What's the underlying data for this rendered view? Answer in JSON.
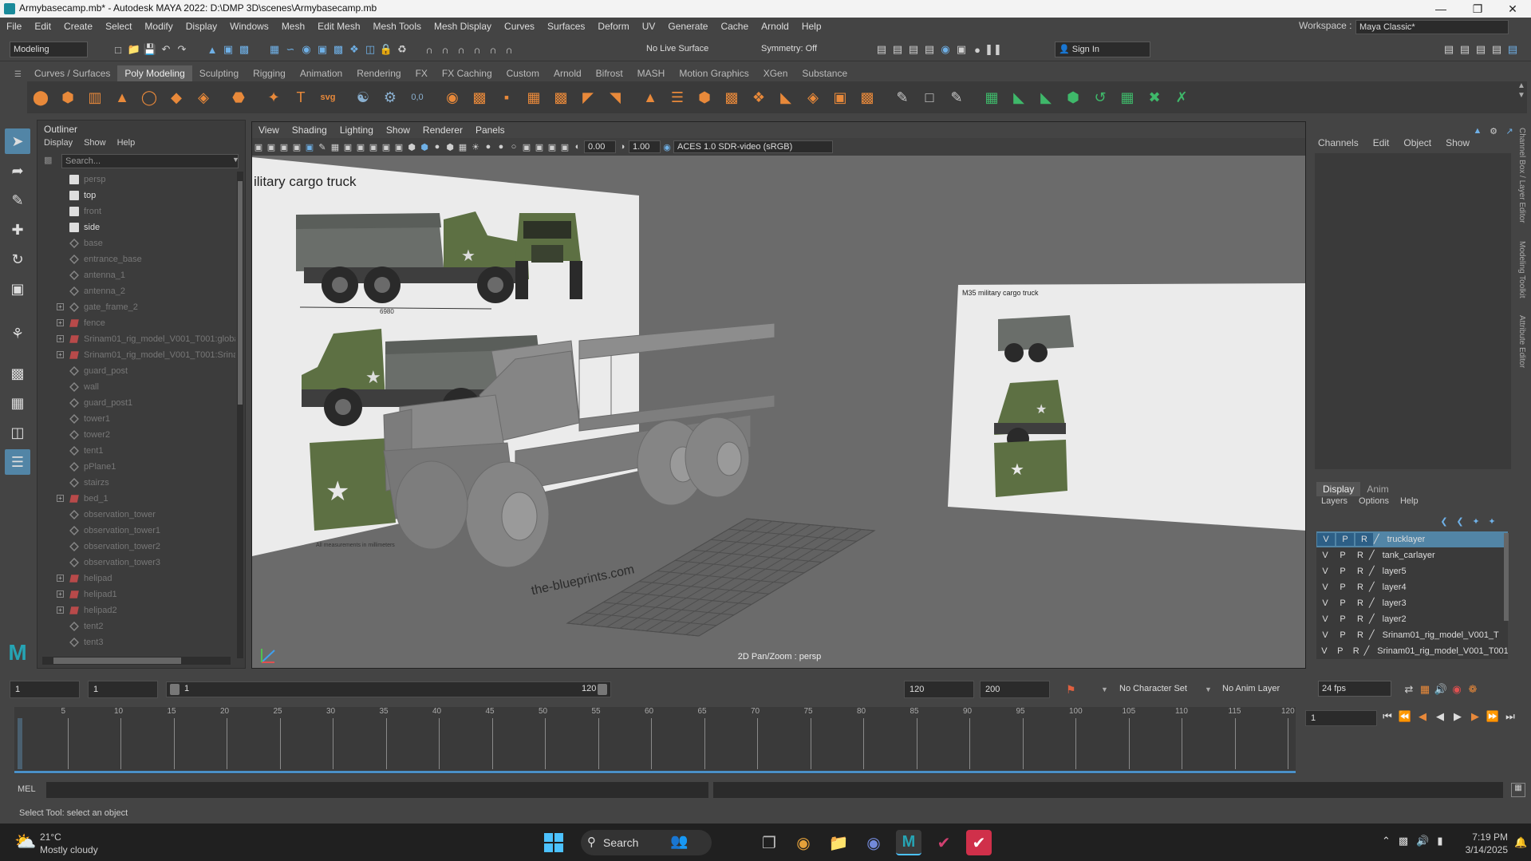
{
  "window": {
    "title": "Armybasecamp.mb* - Autodesk MAYA 2022: D:\\DMP 3D\\scenes\\Armybasecamp.mb"
  },
  "menus": [
    "File",
    "Edit",
    "Create",
    "Select",
    "Modify",
    "Display",
    "Windows",
    "Mesh",
    "Edit Mesh",
    "Mesh Tools",
    "Mesh Display",
    "Curves",
    "Surfaces",
    "Deform",
    "UV",
    "Generate",
    "Cache",
    "Arnold",
    "Help"
  ],
  "workspace": {
    "label": "Workspace :",
    "value": "Maya Classic*"
  },
  "statusline": {
    "mode": "Modeling",
    "live_surface": "No Live Surface",
    "symmetry": "Symmetry: Off",
    "sign_in": "Sign In"
  },
  "shelf_tabs": [
    "Curves / Surfaces",
    "Poly Modeling",
    "Sculpting",
    "Rigging",
    "Animation",
    "Rendering",
    "FX",
    "FX Caching",
    "Custom",
    "Arnold",
    "Bifrost",
    "MASH",
    "Motion Graphics",
    "XGen",
    "Substance"
  ],
  "shelf_active": "Poly Modeling",
  "outliner": {
    "title": "Outliner",
    "menu": [
      "Display",
      "Show",
      "Help"
    ],
    "search_placeholder": "Search...",
    "items": [
      {
        "name": "persp",
        "type": "cam",
        "dim": true,
        "expand": false
      },
      {
        "name": "top",
        "type": "cam",
        "dim": false,
        "expand": false
      },
      {
        "name": "front",
        "type": "cam",
        "dim": true,
        "expand": false
      },
      {
        "name": "side",
        "type": "cam",
        "dim": false,
        "expand": false
      },
      {
        "name": "base",
        "type": "mesh",
        "dim": true,
        "expand": false
      },
      {
        "name": "entrance_base",
        "type": "mesh",
        "dim": true,
        "expand": false
      },
      {
        "name": "antenna_1",
        "type": "mesh",
        "dim": true,
        "expand": false
      },
      {
        "name": "antenna_2",
        "type": "mesh",
        "dim": true,
        "expand": false
      },
      {
        "name": "gate_frame_2",
        "type": "mesh",
        "dim": true,
        "expand": true
      },
      {
        "name": "fence",
        "type": "grp",
        "dim": true,
        "expand": true
      },
      {
        "name": "Srinam01_rig_model_V001_T001:globa",
        "type": "grp",
        "dim": true,
        "expand": true
      },
      {
        "name": "Srinam01_rig_model_V001_T001:Srina",
        "type": "grp",
        "dim": true,
        "expand": true
      },
      {
        "name": "guard_post",
        "type": "mesh",
        "dim": true,
        "expand": false
      },
      {
        "name": "wall",
        "type": "mesh",
        "dim": true,
        "expand": false
      },
      {
        "name": "guard_post1",
        "type": "mesh",
        "dim": true,
        "expand": false
      },
      {
        "name": "tower1",
        "type": "mesh",
        "dim": true,
        "expand": false
      },
      {
        "name": "tower2",
        "type": "mesh",
        "dim": true,
        "expand": false
      },
      {
        "name": "tent1",
        "type": "mesh",
        "dim": true,
        "expand": false
      },
      {
        "name": "pPlane1",
        "type": "mesh",
        "dim": true,
        "expand": false
      },
      {
        "name": "stairzs",
        "type": "mesh",
        "dim": true,
        "expand": false
      },
      {
        "name": "bed_1",
        "type": "grp",
        "dim": true,
        "expand": true
      },
      {
        "name": "observation_tower",
        "type": "mesh",
        "dim": true,
        "expand": false
      },
      {
        "name": "observation_tower1",
        "type": "mesh",
        "dim": true,
        "expand": false
      },
      {
        "name": "observation_tower2",
        "type": "mesh",
        "dim": true,
        "expand": false
      },
      {
        "name": "observation_tower3",
        "type": "mesh",
        "dim": true,
        "expand": false
      },
      {
        "name": "helipad",
        "type": "grp",
        "dim": true,
        "expand": true
      },
      {
        "name": "helipad1",
        "type": "grp",
        "dim": true,
        "expand": true
      },
      {
        "name": "helipad2",
        "type": "grp",
        "dim": true,
        "expand": true
      },
      {
        "name": "tent2",
        "type": "mesh",
        "dim": true,
        "expand": false
      },
      {
        "name": "tent3",
        "type": "mesh",
        "dim": true,
        "expand": false
      }
    ]
  },
  "viewport": {
    "menu": [
      "View",
      "Shading",
      "Lighting",
      "Show",
      "Renderer",
      "Panels"
    ],
    "exposure": "0.00",
    "gamma": "1.00",
    "color_space": "ACES 1.0 SDR-video (sRGB)",
    "hud_label": "2D Pan/Zoom : persp",
    "blueprint_title": "ilitary cargo truck",
    "blueprint_title2": "M35 military cargo truck",
    "blueprint_dim": "6980",
    "blueprint_note": "All measurements in millimeters",
    "floor_text": "the-blueprints.com"
  },
  "channelbox": {
    "menu": [
      "Channels",
      "Edit",
      "Object",
      "Show"
    ],
    "side_tabs": [
      "Channel Box / Layer Editor",
      "Modeling Toolkit",
      "Attribute Editor"
    ]
  },
  "layers": {
    "tabs": [
      "Display",
      "Anim"
    ],
    "menu": [
      "Layers",
      "Options",
      "Help"
    ],
    "items": [
      {
        "name": "trucklayer",
        "selected": true
      },
      {
        "name": "tank_carlayer",
        "selected": false
      },
      {
        "name": "layer5",
        "selected": false
      },
      {
        "name": "layer4",
        "selected": false
      },
      {
        "name": "layer3",
        "selected": false
      },
      {
        "name": "layer2",
        "selected": false
      },
      {
        "name": "Srinam01_rig_model_V001_T",
        "selected": false
      },
      {
        "name": "Srinam01_rig_model_V001_T001:Sri",
        "selected": false
      }
    ]
  },
  "timeslider": {
    "start": "1",
    "current_start": "1",
    "range_start": "1",
    "range_end": "120",
    "end": "120",
    "anim_end": "200",
    "character_set": "No Character Set",
    "anim_layer": "No Anim Layer",
    "fps": "24 fps",
    "current_frame": "1",
    "ticks": [
      "5",
      "10",
      "15",
      "20",
      "25",
      "30",
      "35",
      "40",
      "45",
      "50",
      "55",
      "60",
      "65",
      "70",
      "75",
      "80",
      "85",
      "90",
      "95",
      "100",
      "105",
      "110",
      "115",
      "120"
    ],
    "frame_marker": "1"
  },
  "mel": {
    "label": "MEL"
  },
  "status_text": "Select Tool: select an object",
  "taskbar": {
    "temp": "21°C",
    "weather": "Mostly cloudy",
    "search": "Search",
    "time": "7:19 PM",
    "date": "3/14/2025"
  }
}
